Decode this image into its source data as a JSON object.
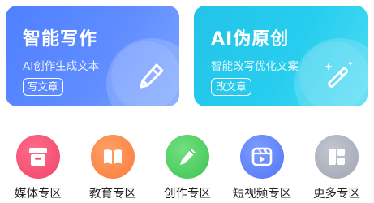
{
  "cards": [
    {
      "title": "智能写作",
      "subtitle": "AI创作生成文本",
      "button": "写文章",
      "icon": "pen-icon"
    },
    {
      "title": "AI伪原创",
      "subtitle": "智能改写优化文案",
      "button": "改文章",
      "icon": "magic-wand-icon"
    }
  ],
  "nav": [
    {
      "label": "媒体专区",
      "icon": "media-box-icon",
      "color": "#f0456a"
    },
    {
      "label": "教育专区",
      "icon": "book-icon",
      "color": "#f97c3e"
    },
    {
      "label": "创作专区",
      "icon": "pencil-icon",
      "color": "#3cc453"
    },
    {
      "label": "短视频专区",
      "icon": "video-play-icon",
      "color": "#5076f5"
    },
    {
      "label": "更多专区",
      "icon": "grid-layout-icon",
      "color": "#a0a5b2"
    }
  ]
}
